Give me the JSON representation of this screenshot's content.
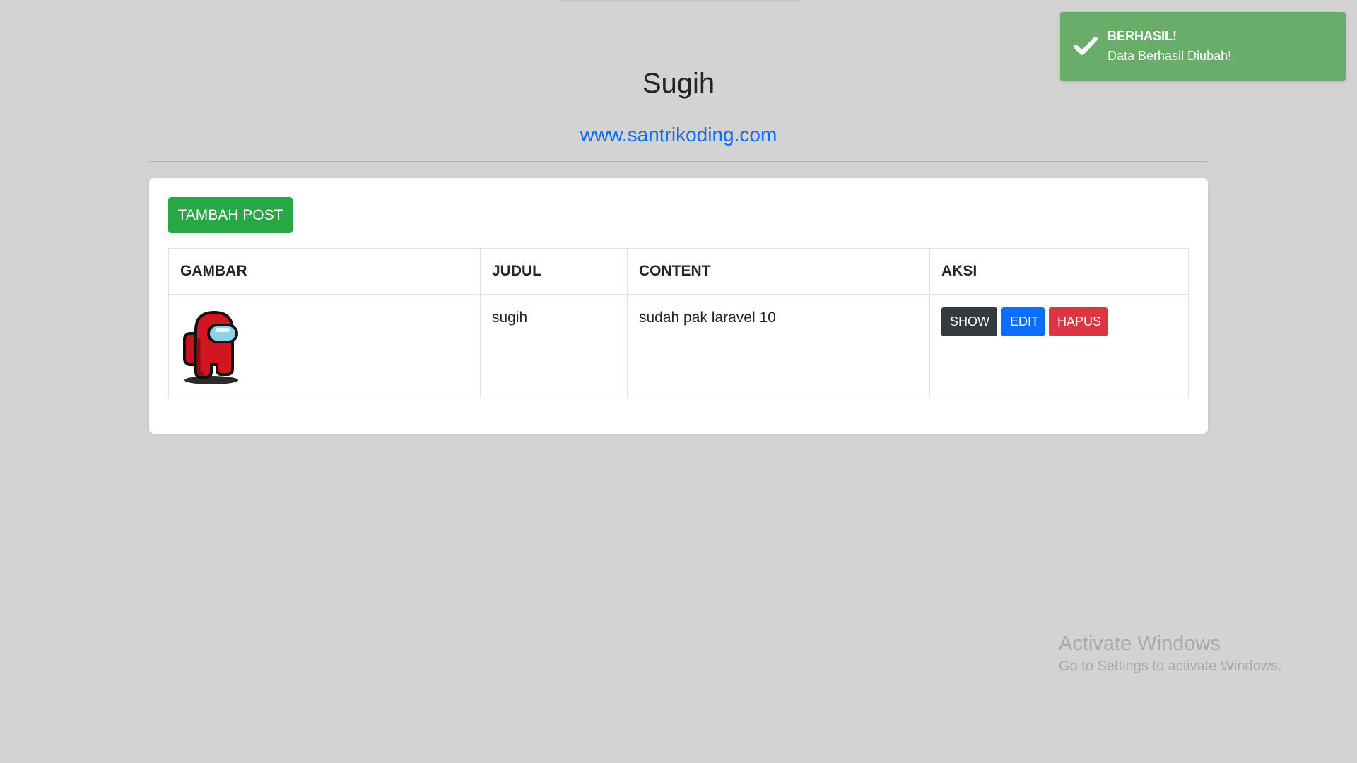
{
  "header": {
    "title": "Sugih",
    "link_text": "www.santrikoding.com"
  },
  "actions": {
    "add_post_label": "TAMBAH POST"
  },
  "table": {
    "columns": [
      "GAMBAR",
      "JUDUL",
      "CONTENT",
      "AKSI"
    ],
    "rows": [
      {
        "image_icon": "among-us-red-crewmate-image",
        "judul": "sugih",
        "content": "sudah pak laravel 10",
        "buttons": {
          "show": "SHOW",
          "edit": "EDIT",
          "hapus": "HAPUS"
        }
      }
    ]
  },
  "toast": {
    "title": "BERHASIL!",
    "message": "Data Berhasil Diubah!",
    "icon": "checkmark-icon",
    "color": "#6aad6b"
  },
  "watermark": {
    "title": "Activate Windows",
    "subtitle": "Go to Settings to activate Windows."
  },
  "colors": {
    "background": "#d3d3d3",
    "success": "#28a745",
    "primary": "#0d6efd",
    "dark": "#343a40",
    "danger": "#dc3545"
  }
}
